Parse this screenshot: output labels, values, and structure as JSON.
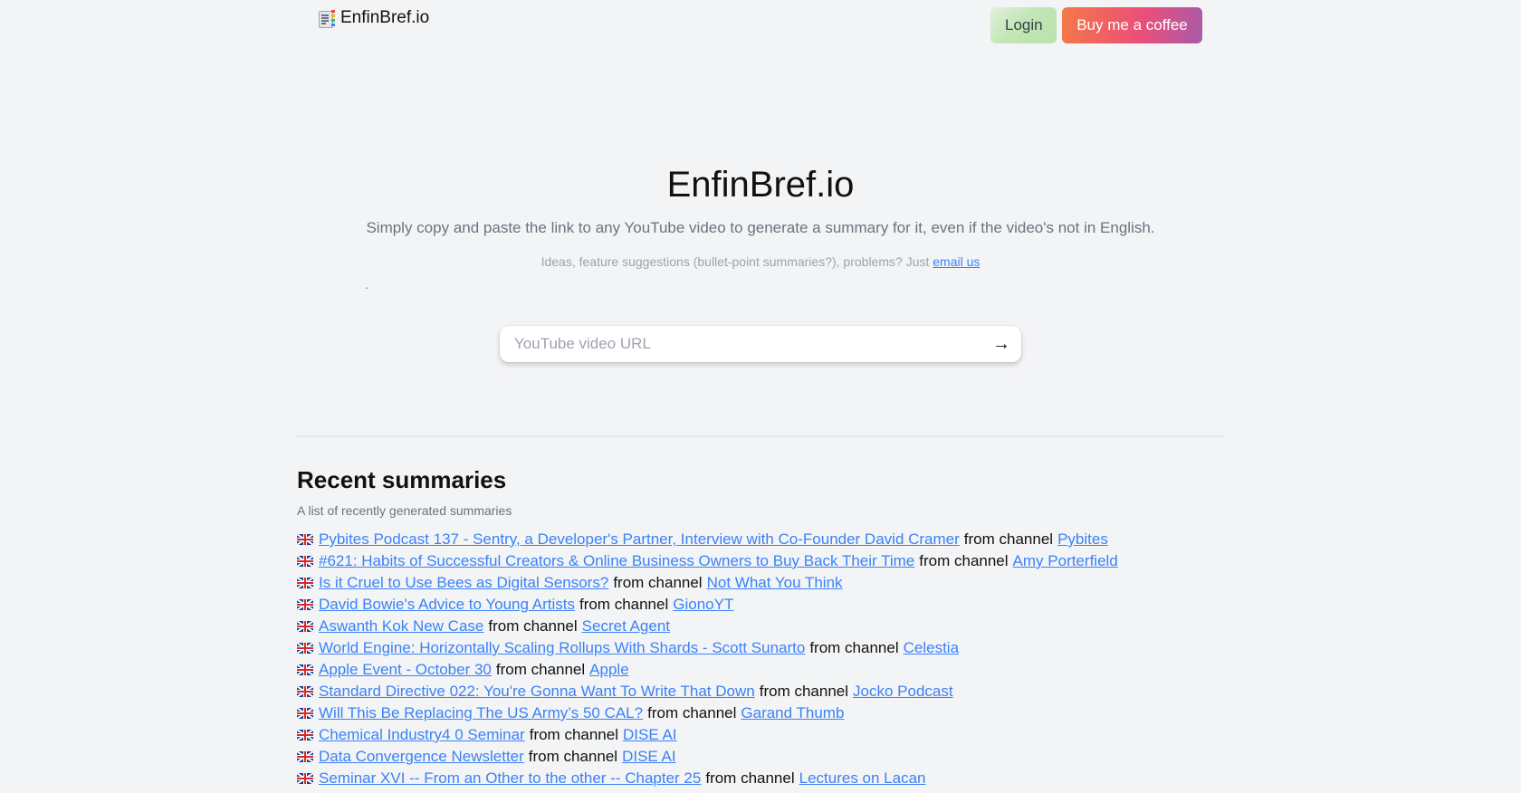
{
  "header": {
    "logo_icon": "bookmark-tabs-icon",
    "logo_text": "EnfinBref.io",
    "login_label": "Login",
    "coffee_label": "Buy me a coffee"
  },
  "hero": {
    "title": "EnfinBref.io",
    "subtitle": "Simply copy and paste the link to any YouTube video to generate a summary for it, even if the video's not in English.",
    "note_prefix": "Ideas, feature suggestions (bullet-point summaries?), problems? Just ",
    "note_link": "email us",
    "dot": "."
  },
  "form": {
    "placeholder": "YouTube video URL",
    "value": "",
    "submit_icon": "→"
  },
  "recent": {
    "title": "Recent summaries",
    "description": "A list of recently generated summaries",
    "from_label": "from channel",
    "language_icon": "uk-flag-icon",
    "items": [
      {
        "title": "Pybites Podcast 137 - Sentry, a Developer's Partner, Interview with Co-Founder David Cramer",
        "channel": "Pybites"
      },
      {
        "title": "#621: Habits of Successful Creators & Online Business Owners to Buy Back Their Time",
        "channel": "Amy Porterfield"
      },
      {
        "title": "Is it Cruel to Use Bees as Digital Sensors?",
        "channel": "Not What You Think"
      },
      {
        "title": "David Bowie's Advice to Young Artists",
        "channel": "GionoYT"
      },
      {
        "title": "Aswanth Kok New Case",
        "channel": "Secret Agent"
      },
      {
        "title": "World Engine: Horizontally Scaling Rollups With Shards - Scott Sunarto",
        "channel": "Celestia"
      },
      {
        "title": "Apple Event - October 30",
        "channel": "Apple"
      },
      {
        "title": "Standard Directive 022: You're Gonna Want To Write That Down",
        "channel": "Jocko Podcast"
      },
      {
        "title": "Will This Be Replacing The US Army’s 50 CAL?",
        "channel": "Garand Thumb"
      },
      {
        "title": "Chemical Industry4 0 Seminar",
        "channel": "DISE AI"
      },
      {
        "title": "Data Convergence Newsletter",
        "channel": "DISE AI"
      },
      {
        "title": "Seminar XVI -- From an Other to the other -- Chapter 25",
        "channel": "Lectures on Lacan"
      }
    ]
  }
}
